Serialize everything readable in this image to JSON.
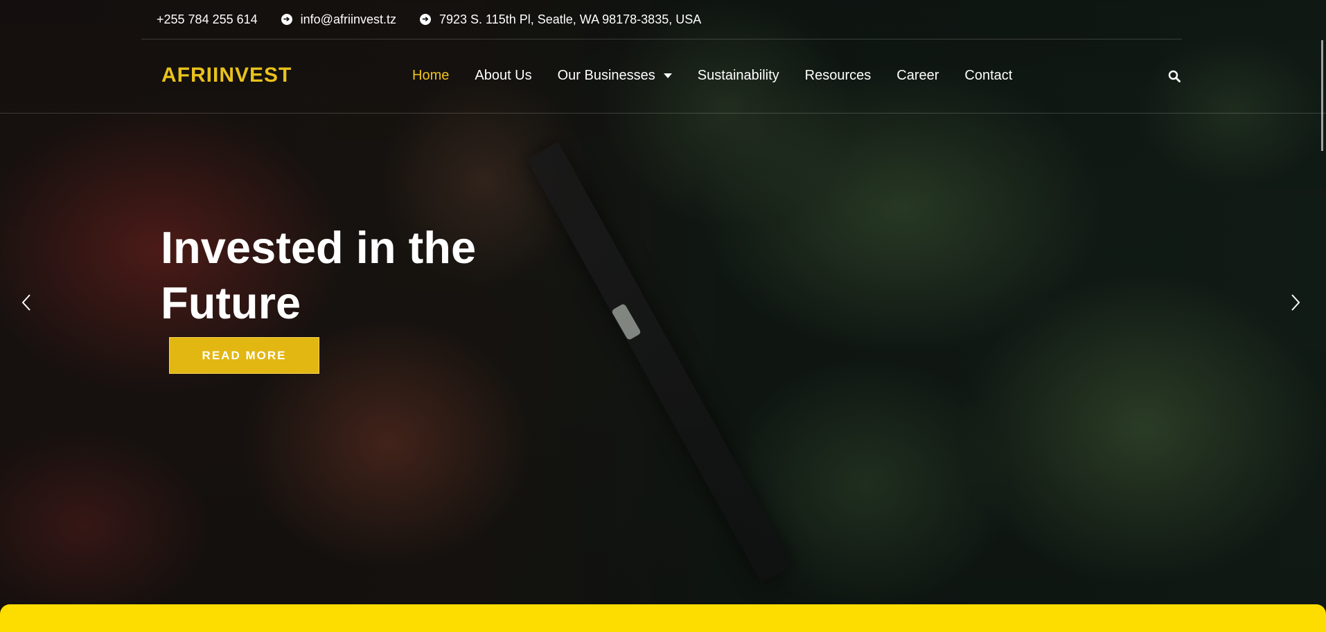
{
  "topbar": {
    "phone": "+255 784 255 614",
    "email": "info@afriinvest.tz",
    "address": "7923 S. 115th Pl, Seatle, WA 98178-3835, USA"
  },
  "header": {
    "logo": "AFRIINVEST",
    "nav": [
      {
        "label": "Home",
        "active": true
      },
      {
        "label": "About Us"
      },
      {
        "label": "Our Businesses",
        "dropdown": true
      },
      {
        "label": "Sustainability"
      },
      {
        "label": "Resources"
      },
      {
        "label": "Career"
      },
      {
        "label": "Contact"
      }
    ],
    "search_icon": "search-icon"
  },
  "hero": {
    "title": "Invested in the Future",
    "button": "READ MORE",
    "prev_icon": "chevron-left-icon",
    "next_icon": "chevron-right-icon"
  },
  "colors": {
    "accent": "#f2c31e",
    "button": "#e3b712",
    "band": "#fddd00"
  }
}
